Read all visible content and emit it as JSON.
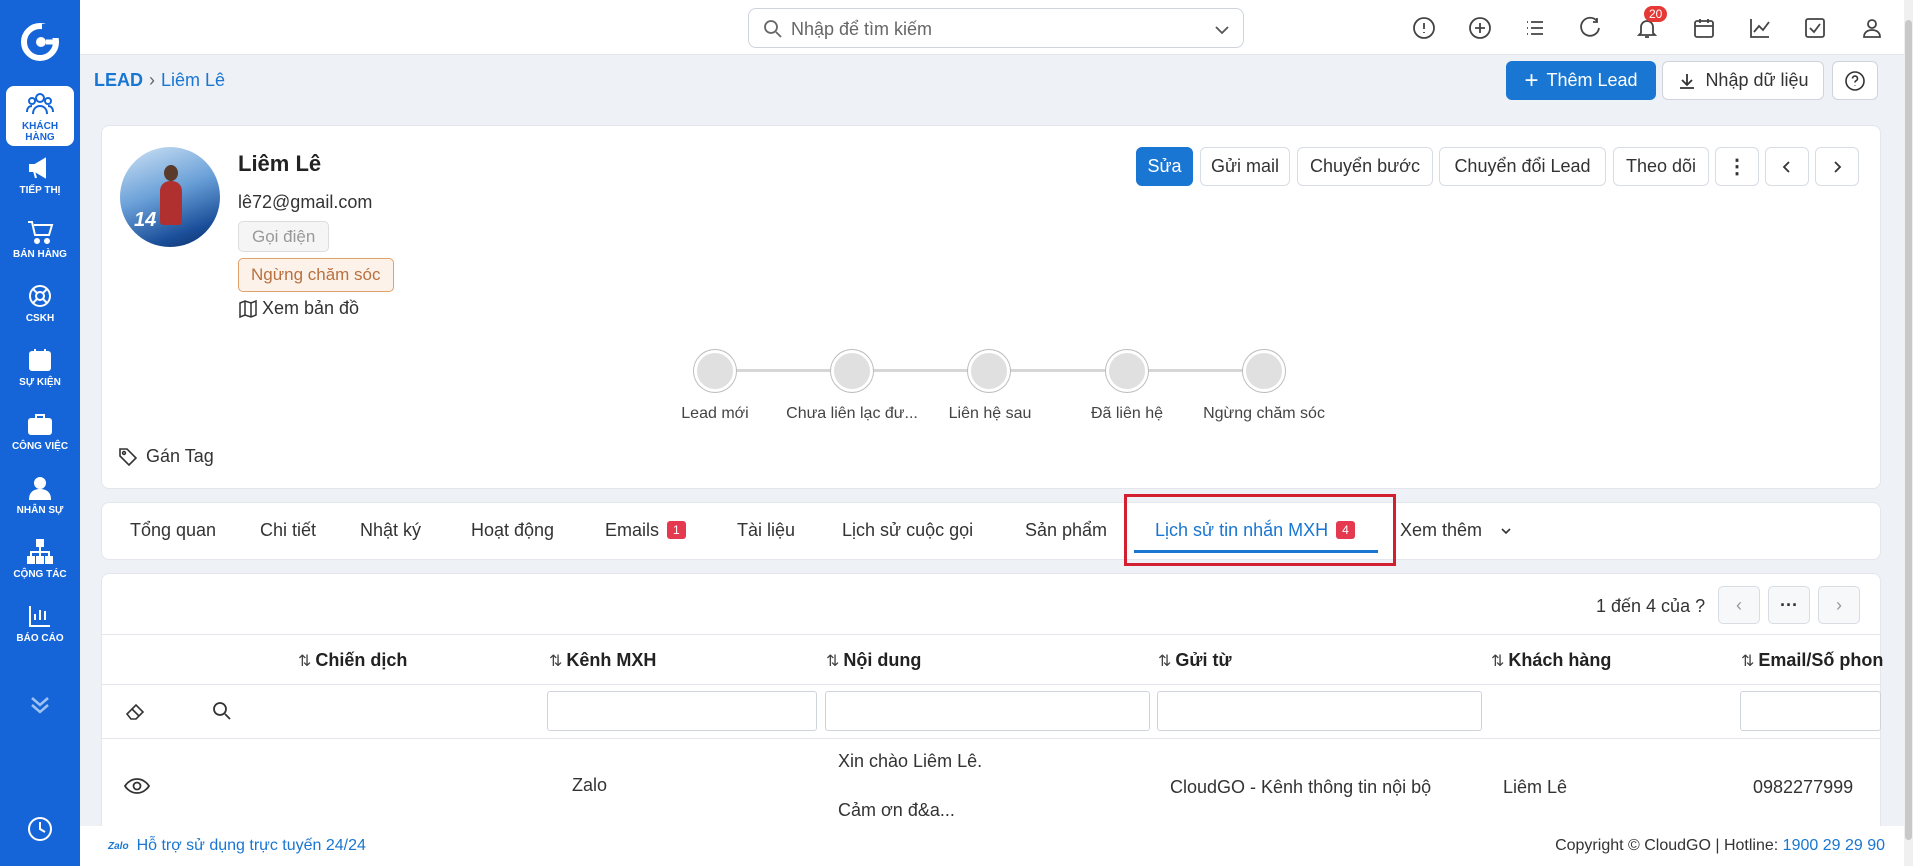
{
  "sidebar": {
    "items": [
      {
        "label": "KHÁCH HÀNG",
        "icon": "customers-icon",
        "active": true
      },
      {
        "label": "TIẾP THỊ",
        "icon": "megaphone-icon"
      },
      {
        "label": "BÁN HÀNG",
        "icon": "cart-icon"
      },
      {
        "label": "CSKH",
        "icon": "lifebuoy-icon"
      },
      {
        "label": "SỰ KIỆN",
        "icon": "calendar-icon"
      },
      {
        "label": "CÔNG VIỆC",
        "icon": "briefcase-icon"
      },
      {
        "label": "NHÂN SỰ",
        "icon": "person-icon"
      },
      {
        "label": "CỘNG TÁC",
        "icon": "org-chart-icon"
      },
      {
        "label": "BÁO CÁO",
        "icon": "report-icon"
      }
    ]
  },
  "topbar": {
    "search_placeholder": "Nhập để tìm kiếm",
    "notification_count": "20"
  },
  "breadcrumb": {
    "root": "LEAD",
    "current": "Liêm Lê"
  },
  "header_actions": {
    "add_lead": "Thêm Lead",
    "import": "Nhập dữ liệu"
  },
  "profile": {
    "name": "Liêm Lê",
    "email": "lê72@gmail.com",
    "call_label": "Gọi điện",
    "status_label": "Ngừng chăm sóc",
    "map_label": "Xem bản đồ",
    "tag_label": "Gán Tag",
    "avatar_number": "14"
  },
  "actions": {
    "edit": "Sửa",
    "send_mail": "Gửi mail",
    "move_step": "Chuyển bước",
    "convert": "Chuyển đổi Lead",
    "follow": "Theo dõi"
  },
  "stepper": [
    "Lead mới",
    "Chưa liên lạc đư...",
    "Liên hệ sau",
    "Đã liên hệ",
    "Ngừng chăm sóc"
  ],
  "tabs": [
    {
      "label": "Tổng quan"
    },
    {
      "label": "Chi tiết"
    },
    {
      "label": "Nhật ký"
    },
    {
      "label": "Hoạt động"
    },
    {
      "label": "Emails",
      "count": "1"
    },
    {
      "label": "Tài liệu"
    },
    {
      "label": "Lịch sử cuộc gọi"
    },
    {
      "label": "Sản phẩm"
    },
    {
      "label": "Lịch sử tin nhắn MXH",
      "count": "4",
      "active": true
    },
    {
      "label": "Xem thêm"
    }
  ],
  "table": {
    "pager_text": "1 đến 4 của",
    "pager_unknown": "?",
    "columns": [
      "Chiến dịch",
      "Kênh MXH",
      "Nội dung",
      "Gửi từ",
      "Khách hàng",
      "Email/Số phon"
    ],
    "rows": [
      {
        "campaign": "",
        "channel": "Zalo",
        "content_line1": "Xin chào Liêm Lê.",
        "content_line2": "Cảm ơn đ&a...",
        "sent_from": "CloudGO - Kênh thông tin nội bộ",
        "customer": "Liêm Lê",
        "phone": "0982277999"
      }
    ]
  },
  "footer": {
    "zalo_badge": "Zalo",
    "support": "Hỗ trợ sử dụng trực tuyến 24/24",
    "copyright": "Copyright © CloudGO | Hotline: ",
    "hotline": "1900 29 29 90"
  },
  "colors": {
    "primary": "#1976d2",
    "sidebar": "#1565d8",
    "danger": "#e53950",
    "highlight": "#d32030"
  }
}
